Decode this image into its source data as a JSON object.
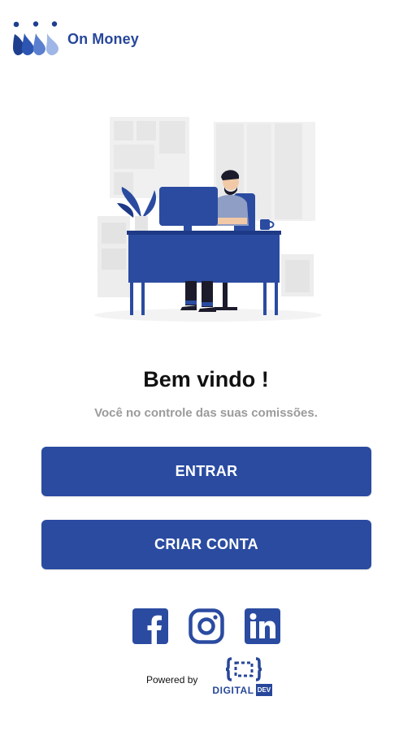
{
  "header": {
    "brand_name": "On Money",
    "logo_icon": "drops-logo-icon"
  },
  "illustration": {
    "description_icon": "person-at-desk-illustration"
  },
  "welcome": {
    "title": "Bem vindo !",
    "subtitle": "Você no controle das suas comissões."
  },
  "buttons": {
    "enter_label": "ENTRAR",
    "signup_label": "CRIAR CONTA"
  },
  "social": [
    {
      "icon": "facebook-icon"
    },
    {
      "icon": "instagram-icon"
    },
    {
      "icon": "linkedin-icon"
    }
  ],
  "footer": {
    "powered_label": "Powered by",
    "brand_digital": "DIGITAL",
    "brand_badge": "DEV"
  },
  "colors": {
    "primary": "#2a4ba0",
    "brand_text": "#27479a",
    "subtitle": "#9b9b9b",
    "title": "#111111"
  }
}
